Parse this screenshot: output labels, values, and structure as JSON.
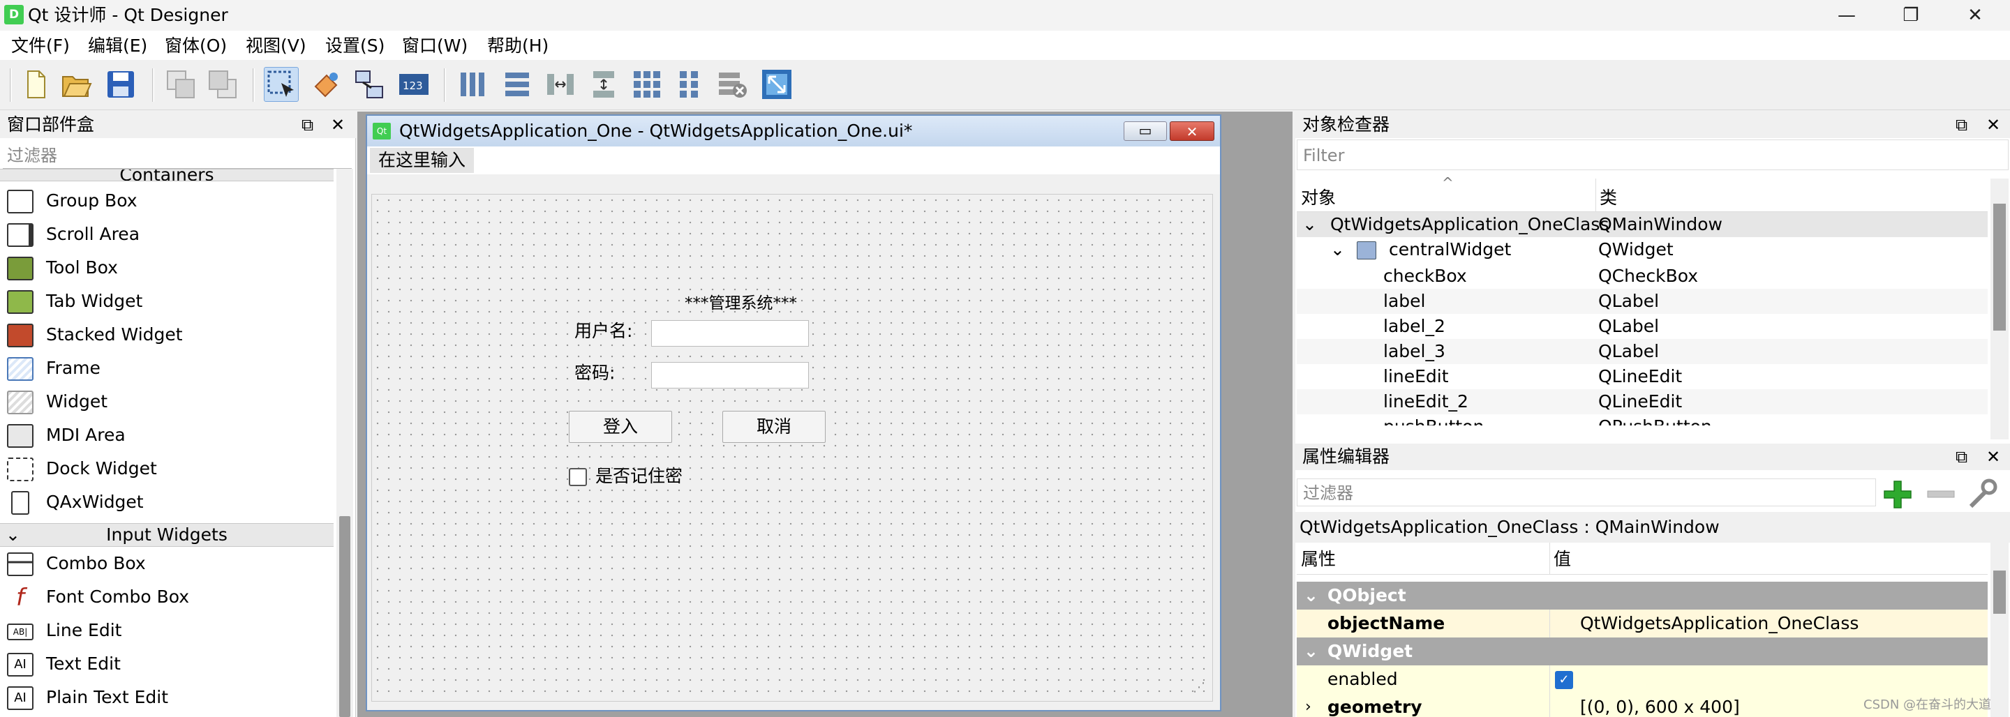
{
  "app": {
    "title": "Qt 设计师 - Qt Designer",
    "icon_text": "D"
  },
  "window_controls": {
    "minimize": "—",
    "restore": "❐",
    "close": "✕"
  },
  "menu": [
    "文件(F)",
    "编辑(E)",
    "窗体(O)",
    "视图(V)",
    "设置(S)",
    "窗口(W)",
    "帮助(H)"
  ],
  "toolbar_icons": [
    "new-icon",
    "open-icon",
    "save-icon",
    "send-to-back-icon",
    "bring-to-front-icon",
    "edit-widgets-icon",
    "edit-signals-slots-icon",
    "edit-buddies-icon",
    "edit-tab-order-icon",
    "layout-horizontal-icon",
    "layout-vertical-icon",
    "layout-horizontal-splitter-icon",
    "layout-vertical-splitter-icon",
    "layout-grid-icon",
    "layout-form-icon",
    "break-layout-icon",
    "adjust-size-icon"
  ],
  "widget_box": {
    "title": "窗口部件盒",
    "filter_placeholder": "过滤器",
    "categories": {
      "containers": "Containers",
      "input": "Input Widgets"
    },
    "containers": [
      "Group Box",
      "Scroll Area",
      "Tool Box",
      "Tab Widget",
      "Stacked Widget",
      "Frame",
      "Widget",
      "MDI Area",
      "Dock Widget",
      "QAxWidget"
    ],
    "inputs": [
      "Combo Box",
      "Font Combo Box",
      "Line Edit",
      "Text Edit",
      "Plain Text Edit"
    ]
  },
  "form": {
    "title": "QtWidgetsApplication_One - QtWidgetsApplication_One.ui*",
    "icon_text": "Qt",
    "menu_placeholder": "在这里输入",
    "heading": "***管理系统***",
    "username_label": "用户名:",
    "password_label": "密码:",
    "login_button": "登入",
    "cancel_button": "取消",
    "remember_checkbox": "是否记住密"
  },
  "object_inspector": {
    "title": "对象检查器",
    "filter_placeholder": "Filter",
    "col_object": "对象",
    "col_class": "类",
    "rows": [
      {
        "name": "QtWidgetsApplication_OneClass",
        "cls": "QMainWindow"
      },
      {
        "name": "centralWidget",
        "cls": "QWidget"
      },
      {
        "name": "checkBox",
        "cls": "QCheckBox"
      },
      {
        "name": "label",
        "cls": "QLabel"
      },
      {
        "name": "label_2",
        "cls": "QLabel"
      },
      {
        "name": "label_3",
        "cls": "QLabel"
      },
      {
        "name": "lineEdit",
        "cls": "QLineEdit"
      },
      {
        "name": "lineEdit_2",
        "cls": "QLineEdit"
      },
      {
        "name": "pushButton",
        "cls": "QPushButton"
      }
    ]
  },
  "property_editor": {
    "title": "属性编辑器",
    "filter_placeholder": "过滤器",
    "class_line": "QtWidgetsApplication_OneClass : QMainWindow",
    "col_property": "属性",
    "col_value": "值",
    "group_qobject": "QObject",
    "object_name_label": "objectName",
    "object_name_value": "QtWidgetsApplication_OneClass",
    "group_qwidget": "QWidget",
    "enabled_label": "enabled",
    "geometry_label": "geometry",
    "geometry_value": "[(0, 0), 600 x 400]"
  },
  "watermark": "CSDN @在奋斗的大道",
  "colors": {
    "accent": "#41cd52",
    "form_border": "#6f93c2",
    "close_red": "#d9453a",
    "group_gray": "#a8a8a8",
    "row_highlight": "#fff8dc"
  }
}
